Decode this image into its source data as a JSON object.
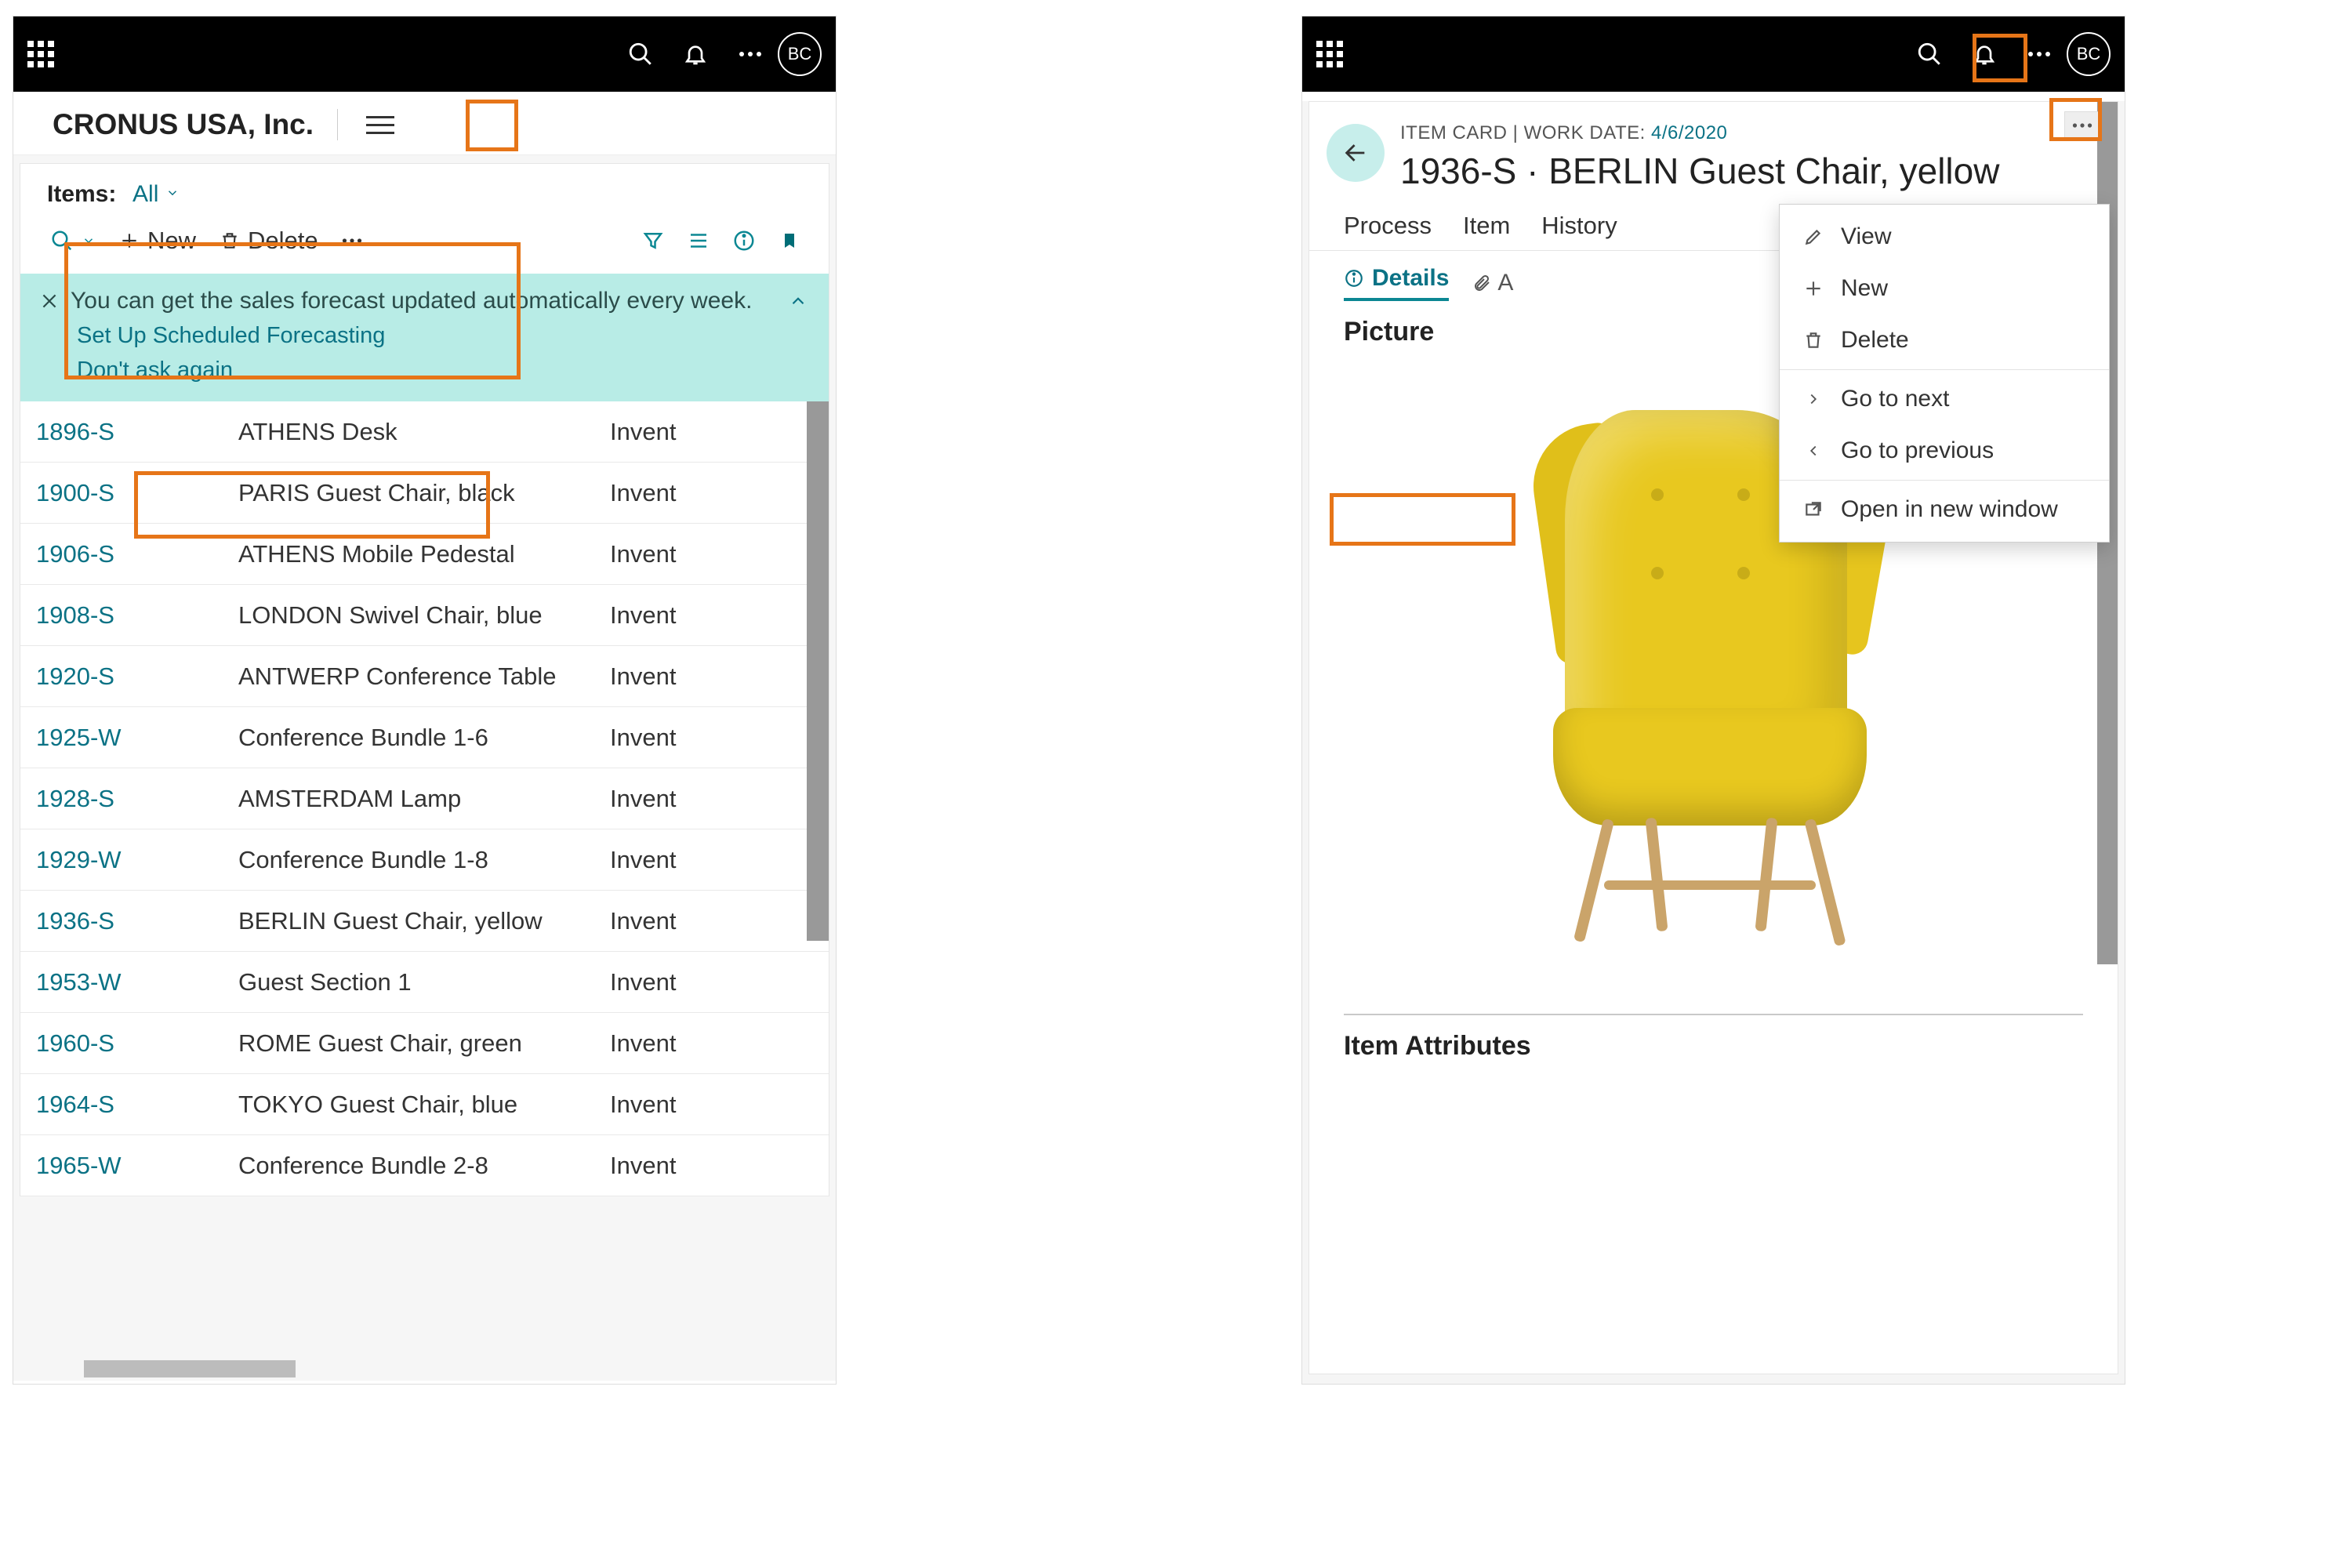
{
  "avatar": "BC",
  "left": {
    "company": "CRONUS USA, Inc.",
    "itemsLabel": "Items:",
    "filter": "All",
    "toolbar": {
      "new": "New",
      "delete": "Delete"
    },
    "banner": {
      "msg": "You can get the sales forecast updated automatically every week.",
      "link1": "Set Up Scheduled Forecasting",
      "link2": "Don't ask again"
    },
    "col3": "Invent",
    "rows": [
      {
        "id": "1896-S",
        "desc": "ATHENS Desk"
      },
      {
        "id": "1900-S",
        "desc": "PARIS Guest Chair, black"
      },
      {
        "id": "1906-S",
        "desc": "ATHENS Mobile Pedestal"
      },
      {
        "id": "1908-S",
        "desc": "LONDON Swivel Chair, blue"
      },
      {
        "id": "1920-S",
        "desc": "ANTWERP Conference Table"
      },
      {
        "id": "1925-W",
        "desc": "Conference Bundle 1-6"
      },
      {
        "id": "1928-S",
        "desc": "AMSTERDAM Lamp"
      },
      {
        "id": "1929-W",
        "desc": "Conference Bundle 1-8"
      },
      {
        "id": "1936-S",
        "desc": "BERLIN Guest Chair, yellow"
      },
      {
        "id": "1953-W",
        "desc": "Guest Section 1"
      },
      {
        "id": "1960-S",
        "desc": "ROME Guest Chair, green"
      },
      {
        "id": "1964-S",
        "desc": "TOKYO Guest Chair, blue"
      },
      {
        "id": "1965-W",
        "desc": "Conference Bundle 2-8"
      }
    ]
  },
  "right": {
    "bcLabel": "ITEM CARD",
    "bcWork": "WORK DATE:",
    "bcDate": "4/6/2020",
    "title": "1936-S · BERLIN Guest Chair, yellow",
    "tabs": [
      "Process",
      "Item",
      "History"
    ],
    "detailsTab": "Details",
    "attachLabel": "A",
    "picture": "Picture",
    "attrs": "Item Attributes",
    "menu": {
      "view": "View",
      "new": "New",
      "delete": "Delete",
      "next": "Go to next",
      "prev": "Go to previous",
      "open": "Open in new window"
    }
  }
}
